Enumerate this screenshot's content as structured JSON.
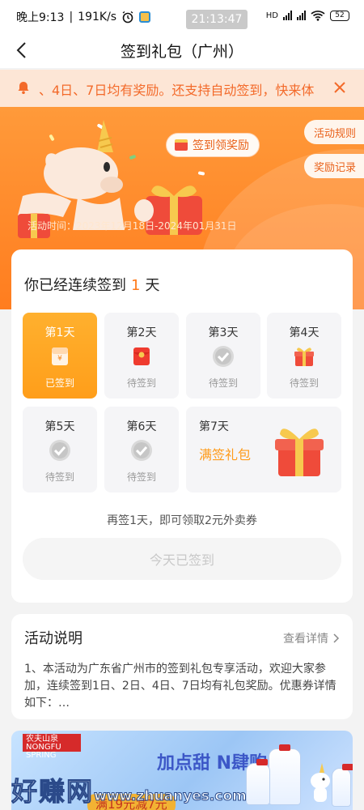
{
  "status_bar": {
    "time": "晚上9:13",
    "speed": "191K/s",
    "clock": "21:13:47",
    "battery": "52",
    "network": "HD"
  },
  "nav": {
    "title": "签到礼包（广州）"
  },
  "notice": {
    "text": "、4日、7日均有奖励。还支持自动签到，快来体"
  },
  "hero": {
    "badge_label": "签到领奖励",
    "rules_label": "活动规则",
    "records_label": "奖励记录",
    "period": "活动时间：2023年12月18日-2024年01月31日"
  },
  "sign": {
    "heading_prefix": "你已经连续签到",
    "streak": "1",
    "heading_suffix": "天",
    "days": [
      {
        "label": "第1天",
        "status": "已签到",
        "icon": "red-envelope-icon"
      },
      {
        "label": "第2天",
        "status": "待签到",
        "icon": "red-envelope-icon"
      },
      {
        "label": "第3天",
        "status": "待签到",
        "icon": "check-coin-icon"
      },
      {
        "label": "第4天",
        "status": "待签到",
        "icon": "gift-box-icon"
      },
      {
        "label": "第5天",
        "status": "待签到",
        "icon": "check-coin-icon"
      },
      {
        "label": "第6天",
        "status": "待签到",
        "icon": "check-coin-icon"
      },
      {
        "label": "第7天",
        "status": "满签礼包",
        "icon": "gift-box-icon"
      }
    ],
    "tip": "再签1天，即可领取2元外卖券",
    "button_label": "今天已签到"
  },
  "activity": {
    "title": "活动说明",
    "more_label": "查看详情",
    "description": "1、本活动为广东省广州市的签到礼包专享活动，欢迎大家参加，连续签到1日、2日、4日、7日均有礼包奖励。优惠券详情如下：…"
  },
  "ad": {
    "brand": "农夫山泉 NONGFU SPRING",
    "slogan": "加点甜 N肆购",
    "promo": "满19元减7元",
    "watermark": "好赚网",
    "watermark_url": "www.zhuanyes.com"
  },
  "colors": {
    "accent": "#ff7a1a",
    "done_day": "#ffa726",
    "notice_bg": "#fde6d6",
    "notice_text": "#f36a2a"
  }
}
